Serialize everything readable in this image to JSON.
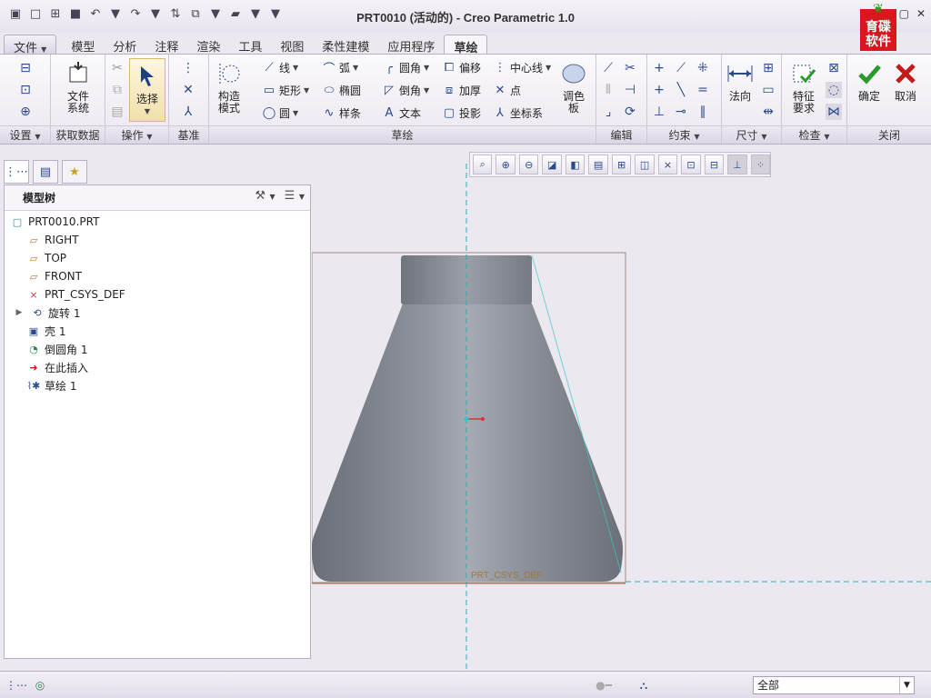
{
  "window": {
    "title": "PRT0010 (活动的) - Creo Parametric 1.0",
    "logo_text": "育碟软件"
  },
  "ribbon_tabs": [
    "文件",
    "模型",
    "分析",
    "注释",
    "渲染",
    "工具",
    "视图",
    "柔性建模",
    "应用程序",
    "草绘"
  ],
  "groups": {
    "setup": "设置",
    "get_data": "获取数据",
    "operations": "操作",
    "datum": "基准",
    "sketching": "草绘",
    "editing": "编辑",
    "constrain": "约束",
    "dimension": "尺寸",
    "inspect": "检查",
    "close": "关闭"
  },
  "buttons": {
    "file_system": "文件\n系统",
    "select": "选择",
    "construction_mode": "构造\n模式",
    "line": "线",
    "arc": "弧",
    "fillet": "圆角",
    "offset": "偏移",
    "centerline": "中心线",
    "rectangle": "矩形",
    "ellipse": "椭圆",
    "chamfer": "倒角",
    "thicken": "加厚",
    "point": "点",
    "circle": "圆",
    "spline": "样条",
    "text": "文本",
    "project": "投影",
    "coordinate_system": "坐标系",
    "palette": "调色\n板",
    "normal": "法向",
    "feature_requirements": "特征\n要求",
    "ok": "确定",
    "cancel": "取消"
  },
  "model_tree": {
    "header": "模型树",
    "items": [
      "PRT0010.PRT",
      "RIGHT",
      "TOP",
      "FRONT",
      "PRT_CSYS_DEF",
      "旋转 1",
      "壳 1",
      "倒圆角 1",
      "在此插入",
      "草绘 1"
    ]
  },
  "graphics": {
    "csys_label": "PRT_CSYS_DEF"
  },
  "status": {
    "filter_value": "全部"
  }
}
